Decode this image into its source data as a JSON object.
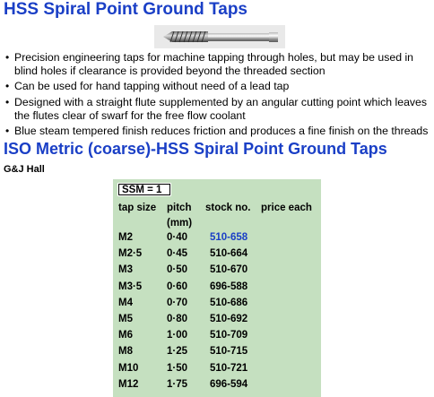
{
  "heading": "HSS Spiral Point Ground Taps",
  "bullets": [
    "Precision engineering taps for machine tapping through holes, but may be used in blind holes if clearance is provided beyond the threaded section",
    "Can be used for hand tapping without need of a lead tap",
    "Designed with a straight flute supplemented by an angular cutting point which leaves the flutes clear of swarf for the free flow coolant",
    "Blue steam tempered finish reduces friction and produces a fine finish on the threads"
  ],
  "section_title": "ISO Metric (coarse)-HSS Spiral Point Ground Taps",
  "supplier": "G&J Hall",
  "table": {
    "ssm_label": "SSM = 1",
    "headers": {
      "tap_size": "tap size",
      "pitch": "pitch",
      "pitch_unit": "(mm)",
      "stock_no": "stock no.",
      "price_each": "price each"
    },
    "rows": [
      {
        "size": "M2",
        "pitch": "0·40",
        "stock": "510-658"
      },
      {
        "size": "M2·5",
        "pitch": "0·45",
        "stock": "510-664"
      },
      {
        "size": "M3",
        "pitch": "0·50",
        "stock": "510-670"
      },
      {
        "size": "M3·5",
        "pitch": "0·60",
        "stock": "696-588"
      },
      {
        "size": "M4",
        "pitch": "0·70",
        "stock": "510-686"
      },
      {
        "size": "M5",
        "pitch": "0·80",
        "stock": "510-692"
      },
      {
        "size": "M6",
        "pitch": "1·00",
        "stock": "510-709"
      },
      {
        "size": "M8",
        "pitch": "1·25",
        "stock": "510-715"
      },
      {
        "size": "M10",
        "pitch": "1·50",
        "stock": "510-721"
      },
      {
        "size": "M12",
        "pitch": "1·75",
        "stock": "696-594"
      }
    ]
  },
  "colors": {
    "heading": "#1a3fc6",
    "panel": "#c5e0c0",
    "link": "#1a3fc6"
  },
  "icons": {
    "product_image": "spiral-point-tap-image"
  }
}
